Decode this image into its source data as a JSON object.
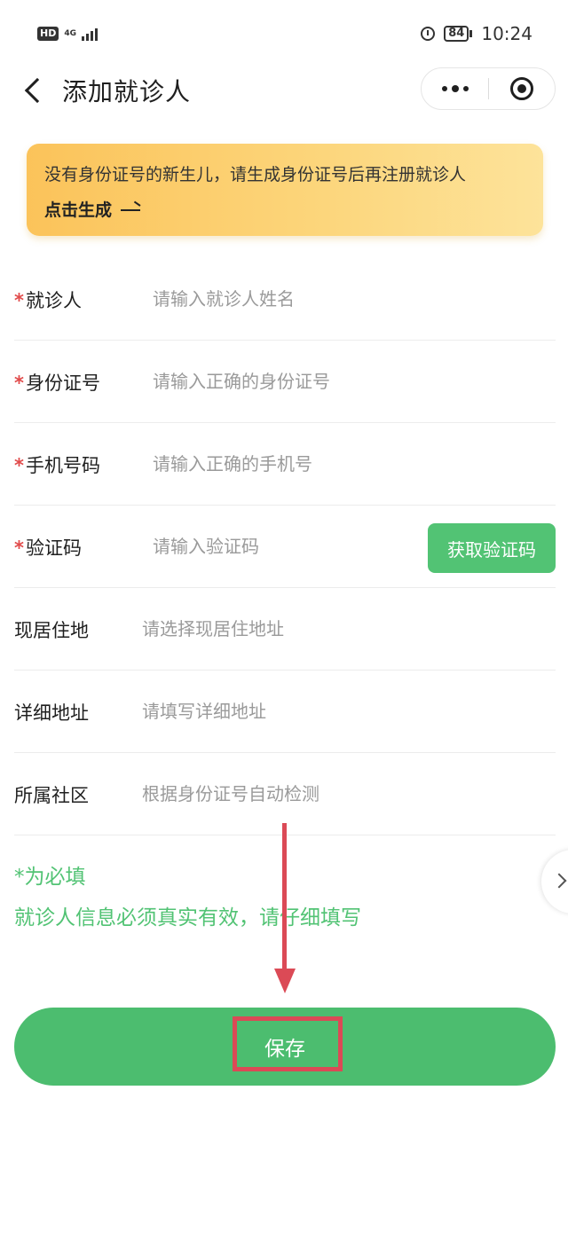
{
  "status_bar": {
    "hd": "HD",
    "network": "4G",
    "battery": "84",
    "time": "10:24"
  },
  "nav": {
    "title": "添加就诊人"
  },
  "banner": {
    "text": "没有身份证号的新生儿，请生成身份证号后再注册就诊人",
    "link": "点击生成"
  },
  "form": {
    "patient_name": {
      "required": "*",
      "label": "就诊人",
      "placeholder": "请输入就诊人姓名"
    },
    "id_number": {
      "required": "*",
      "label": "身份证号",
      "placeholder": "请输入正确的身份证号"
    },
    "phone": {
      "required": "*",
      "label": "手机号码",
      "placeholder": "请输入正确的手机号"
    },
    "code": {
      "required": "*",
      "label": "验证码",
      "placeholder": "请输入验证码",
      "button": "获取验证码"
    },
    "residence": {
      "label": "现居住地",
      "placeholder": "请选择现居住地址"
    },
    "address_detail": {
      "label": "详细地址",
      "placeholder": "请填写详细地址"
    },
    "community": {
      "label": "所属社区",
      "placeholder": "根据身份证号自动检测"
    }
  },
  "notes": {
    "required_hint": "*为必填",
    "truth_hint": "就诊人信息必须真实有效，请仔细填写"
  },
  "save_button": {
    "label": "保存"
  },
  "colors": {
    "primary_green": "#4cbd6f",
    "required_red": "#e14b4b",
    "annotation_red": "#db4a56",
    "banner_yellow": "#fcd57a"
  }
}
